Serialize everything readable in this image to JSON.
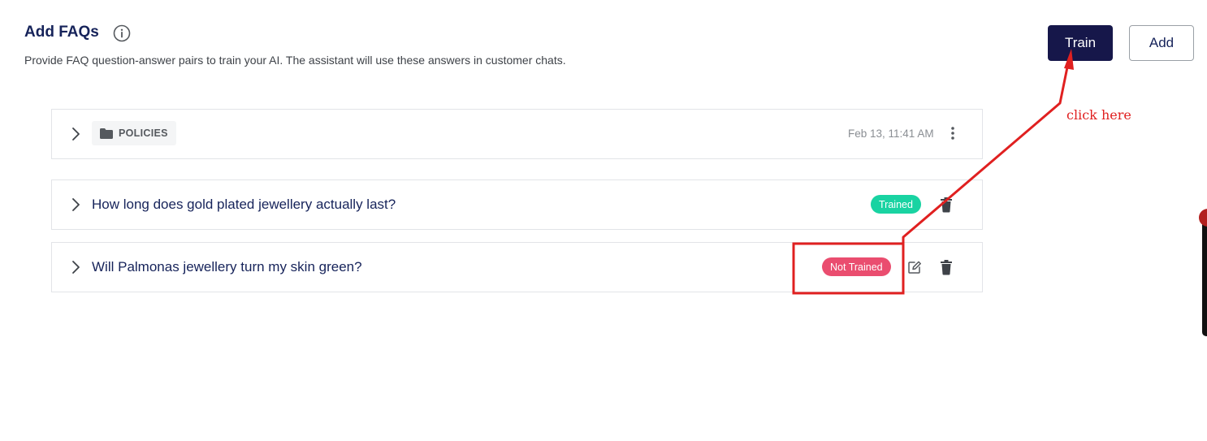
{
  "header": {
    "title": "Add FAQs",
    "subtitle": "Provide FAQ question-answer pairs to train your AI. The assistant will use these answers in customer chats.",
    "info_icon": "info-circle-icon",
    "train_label": "Train",
    "add_label": "Add"
  },
  "folder": {
    "name": "POLICIES",
    "timestamp": "Feb 13, 11:41 AM",
    "icon": "folder-icon"
  },
  "faqs": [
    {
      "question": "How long does gold plated jewellery actually last?",
      "status": "Trained"
    },
    {
      "question": "Will Palmonas jewellery turn my skin green?",
      "status": "Not Trained"
    }
  ],
  "annotation": {
    "text": "click here"
  },
  "colors": {
    "primary": "#16174a",
    "heading": "#16235a",
    "trained": "#19d3a2",
    "not_trained": "#ea4d6f",
    "annotation": "#e02020"
  }
}
